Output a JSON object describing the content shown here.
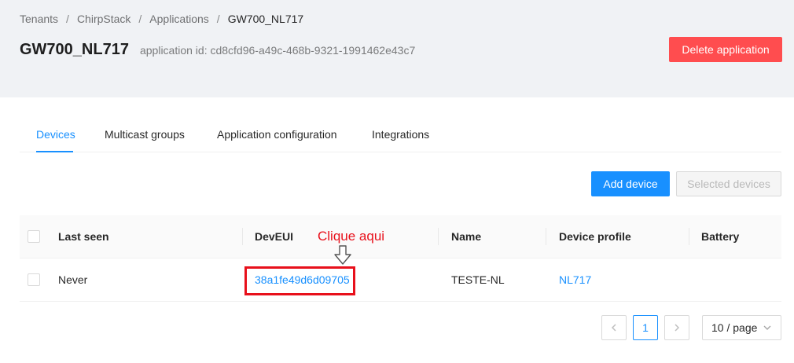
{
  "breadcrumb": {
    "items": [
      "Tenants",
      "ChirpStack",
      "Applications",
      "GW700_NL717"
    ],
    "separator": "/"
  },
  "header": {
    "title": "GW700_NL717",
    "subtitle": "application id: cd8cfd96-a49c-468b-9321-1991462e43c7",
    "delete_label": "Delete application"
  },
  "tabs": [
    {
      "label": "Devices",
      "active": true
    },
    {
      "label": "Multicast groups",
      "active": false
    },
    {
      "label": "Application configuration",
      "active": false
    },
    {
      "label": "Integrations",
      "active": false
    }
  ],
  "toolbar": {
    "add_label": "Add device",
    "selected_label": "Selected devices"
  },
  "table": {
    "columns": [
      "Last seen",
      "DevEUI",
      "Name",
      "Device profile",
      "Battery"
    ],
    "rows": [
      {
        "last_seen": "Never",
        "dev_eui": "38a1fe49d6d09705",
        "name": "TESTE-NL",
        "device_profile": "NL717",
        "battery": ""
      }
    ]
  },
  "annotation": {
    "text": "Clique aqui",
    "color": "#e8101b"
  },
  "pagination": {
    "prev_icon": "chevron-left-icon",
    "current_page": "1",
    "next_icon": "chevron-right-icon",
    "page_size": "10 / page"
  },
  "colors": {
    "primary": "#1890ff",
    "danger": "#ff4d4f",
    "header_bg": "#f0f2f5"
  }
}
